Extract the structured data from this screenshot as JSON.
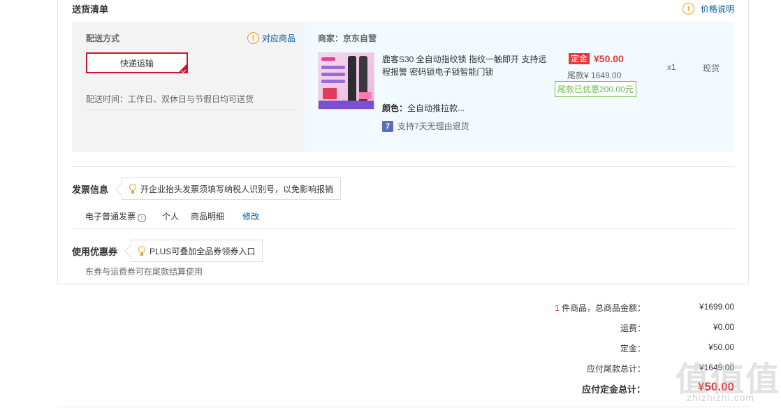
{
  "delivery": {
    "title": "送货清单",
    "price_info_icon": "!",
    "price_info_label": "价格说明"
  },
  "shipping": {
    "label": "配送方式",
    "match_icon": "!",
    "match_label": "对应商品",
    "method": "快递运输",
    "time_text": "配送时间：工作日、双休日与节假日均可送货"
  },
  "seller": {
    "label": "商家：京东自营"
  },
  "product": {
    "title_line1": "鹿客S30 全自动指纹锁 指纹一触即开 支持远",
    "title_line2": "程报警 密码锁电子锁智能门锁",
    "deposit_tag": "定金",
    "deposit_price": "¥50.00",
    "balance": "尾款¥ 1649.00",
    "balance_discount": "尾款已优惠200.00元",
    "quantity": "x1",
    "stock": "现货",
    "color_label": "颜色：",
    "color_value": "全自动推拉款...",
    "return_icon": "7",
    "return_text": "支持7天无理由退货"
  },
  "invoice": {
    "title": "发票信息",
    "tip": "开企业抬头发票须填写纳税人识别号，以免影响报销",
    "type": "电子普通发票",
    "info_icon": "!",
    "holder": "个人",
    "content": "商品明细",
    "edit": "修改"
  },
  "coupon": {
    "title": "使用优惠券",
    "tip": "PLUS可叠加全品券领券入口",
    "note": "东券与运费券可在尾款结算使用"
  },
  "summary": {
    "count": "1",
    "count_label": "件商品，总商品金额：",
    "total": "¥1699.00",
    "shipping_label": "运费：",
    "shipping": "¥0.00",
    "deposit_label": "定金：",
    "deposit": "¥50.00",
    "balance_label": "应付尾款总计：",
    "balance": "¥1649.00",
    "deposit_total_label": "应付定金总计：",
    "deposit_total": "¥50.00"
  },
  "watermark": {
    "big": "值值值",
    "small": "zhizhizhi.com"
  }
}
